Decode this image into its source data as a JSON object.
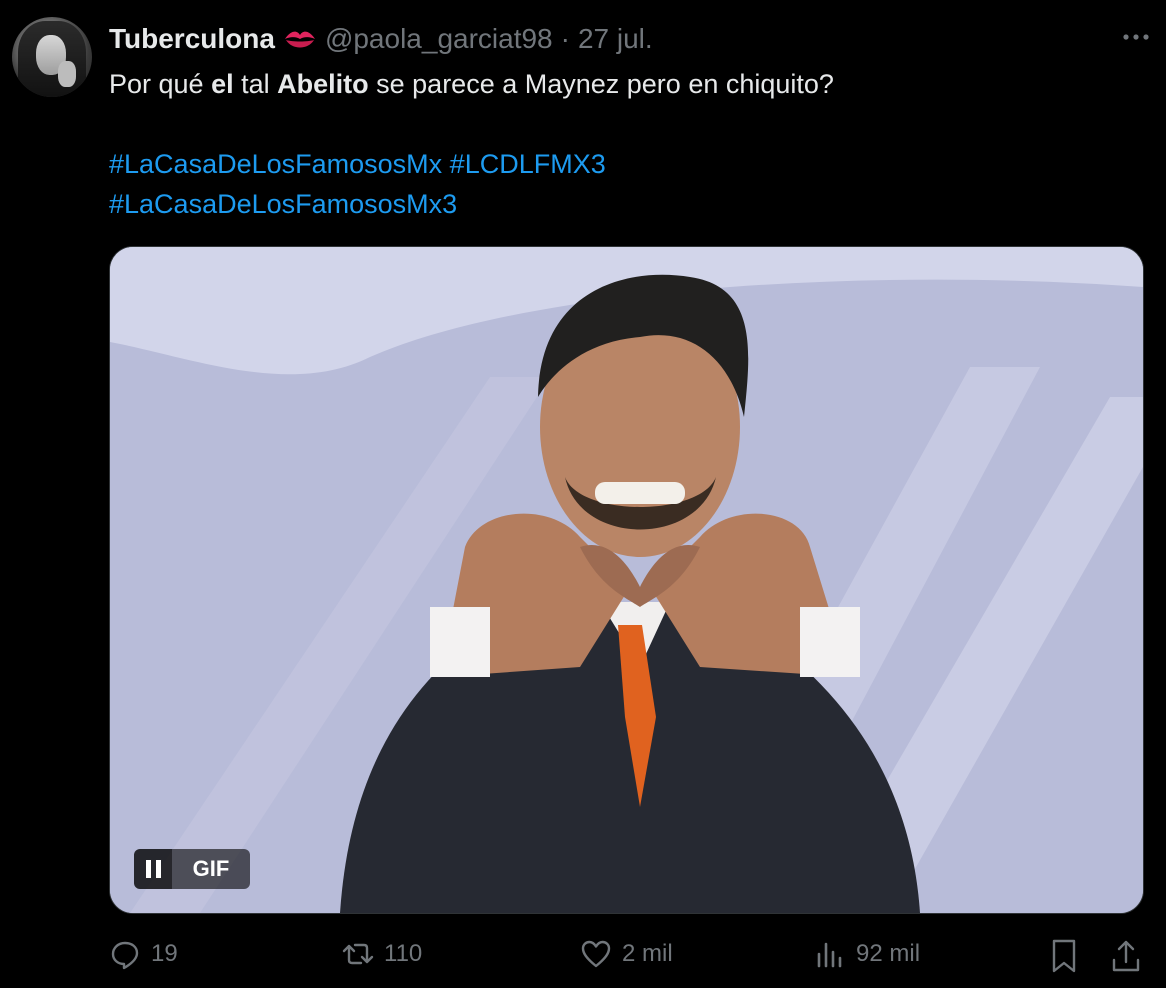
{
  "tweet": {
    "author_name": "Tuberculona",
    "author_emoji": "kiss-mark-icon",
    "handle": "@paola_garciat98",
    "separator": "·",
    "date": "27 jul.",
    "text": {
      "p1": "Por qué ",
      "p2": "el",
      "p3": " tal ",
      "p4": "Abelito",
      "p5": " se parece a Maynez pero en chiquito?"
    },
    "hashtags": [
      "#LaCasaDeLosFamososMx",
      "#LCDLFMX3",
      "#LaCasaDeLosFamososMx3"
    ]
  },
  "media": {
    "type": "gif",
    "badge_label": "GIF",
    "control_icon": "pause-icon"
  },
  "actions": {
    "replies": "19",
    "reposts": "110",
    "likes": "2 mil",
    "views": "92 mil"
  },
  "colors": {
    "background": "#000000",
    "text": "#e7e9ea",
    "muted": "#71767b",
    "link": "#1d9bf0",
    "emoji_red": "#e0245e"
  }
}
